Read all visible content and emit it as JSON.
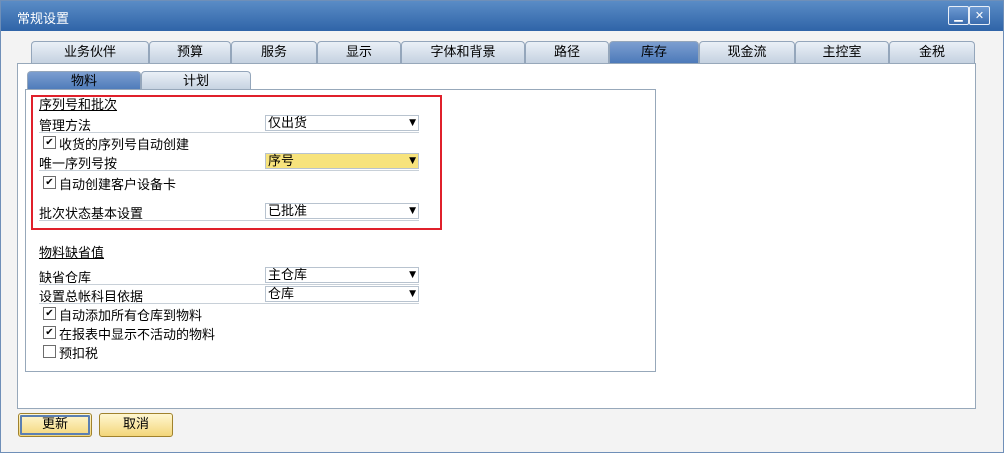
{
  "window": {
    "title": "常规设置"
  },
  "tabs": [
    "业务伙伴",
    "预算",
    "服务",
    "显示",
    "字体和背景",
    "路径",
    "库存",
    "现金流",
    "主控室",
    "金税"
  ],
  "subtabs": [
    "物料",
    "计划"
  ],
  "serial_section": {
    "title": "序列号和批次",
    "management_method_label": "管理方法",
    "management_method_value": "仅出货",
    "auto_create_serial_label": "收货的序列号自动创建",
    "unique_serial_label": "唯一序列号按",
    "unique_serial_value": "序号",
    "auto_create_equipment_label": "自动创建客户设备卡",
    "batch_status_label": "批次状态基本设置",
    "batch_status_value": "已批准"
  },
  "item_defaults": {
    "title": "物料缺省值",
    "default_warehouse_label": "缺省仓库",
    "default_warehouse_value": "主仓库",
    "gl_account_label": "设置总帐科目依据",
    "gl_account_value": "仓库",
    "auto_add_warehouses_label": "自动添加所有仓库到物料",
    "show_inactive_label": "在报表中显示不活动的物料",
    "withholding_label": "预扣税"
  },
  "checkboxes": {
    "auto_create_serial": true,
    "auto_create_equipment": true,
    "auto_add_warehouses": true,
    "show_inactive": true,
    "withholding": false
  },
  "buttons": {
    "update": "更新",
    "cancel": "取消"
  },
  "colors": {
    "highlight_box": "#e0202b",
    "active_tab": "#4a78b8",
    "yellow_field": "#f7e37c"
  },
  "icons": {
    "dropdown": "chevron-down-icon",
    "minimize": "minimize-icon",
    "close": "close-icon"
  }
}
